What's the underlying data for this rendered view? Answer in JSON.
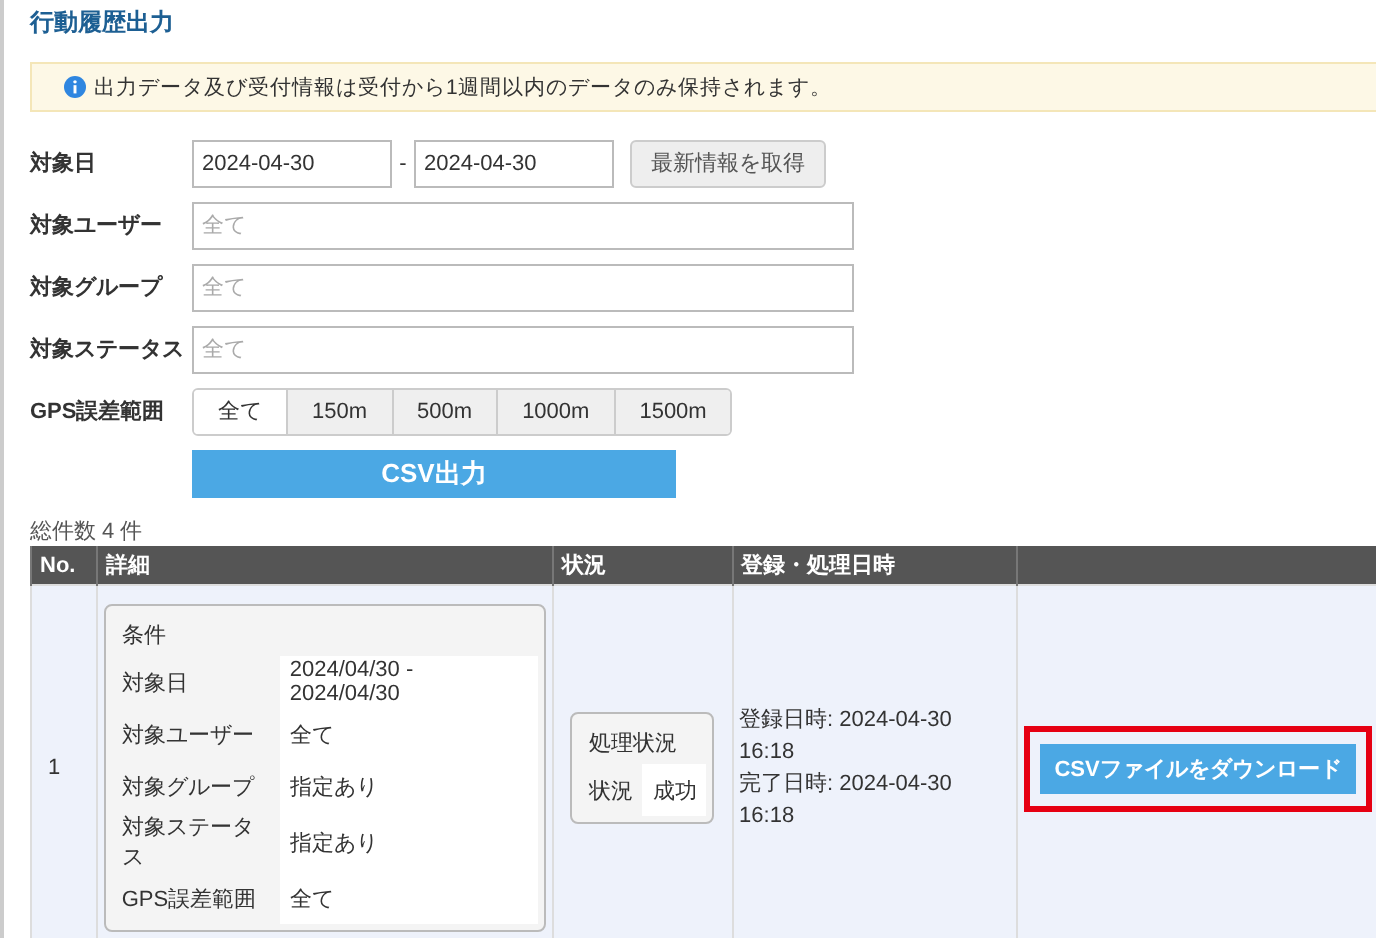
{
  "page_title": "行動履歴出力",
  "notice": "出力データ及び受付情報は受付から1週間以内のデータのみ保持されます。",
  "form": {
    "date": {
      "label": "対象日",
      "from": "2024-04-30",
      "separator": "-",
      "to": "2024-04-30",
      "refresh_button": "最新情報を取得"
    },
    "fields": [
      {
        "label": "対象ユーザー",
        "placeholder": "全て"
      },
      {
        "label": "対象グループ",
        "placeholder": "全て"
      },
      {
        "label": "対象ステータス",
        "placeholder": "全て"
      }
    ],
    "gps": {
      "label": "GPS誤差範囲",
      "options": [
        {
          "label": "全て",
          "selected": true
        },
        {
          "label": "150m",
          "selected": false
        },
        {
          "label": "500m",
          "selected": false
        },
        {
          "label": "1000m",
          "selected": false
        },
        {
          "label": "1500m",
          "selected": false
        }
      ]
    },
    "submit_button": "CSV出力"
  },
  "total": "総件数 4 件",
  "table": {
    "columns": [
      "No.",
      "詳細",
      "状況",
      "登録・処理日時",
      ""
    ],
    "rows": [
      {
        "no": "1",
        "conditions_title": "条件",
        "conditions": [
          {
            "label": "対象日",
            "value": "2024/04/30 - 2024/04/30"
          },
          {
            "label": "対象ユーザー",
            "value": "全て"
          },
          {
            "label": "対象グループ",
            "value": "指定あり"
          },
          {
            "label": "対象ステータス",
            "value": "指定あり"
          },
          {
            "label": "GPS誤差範囲",
            "value": "全て"
          }
        ],
        "status_title": "処理状況",
        "status_label": "状況",
        "status_value": "成功",
        "registered": "登録日時: 2024-04-30 16:18",
        "completed": "完了日時: 2024-04-30 16:18",
        "download_button": "CSVファイルをダウンロード",
        "highlighted": true
      }
    ]
  }
}
